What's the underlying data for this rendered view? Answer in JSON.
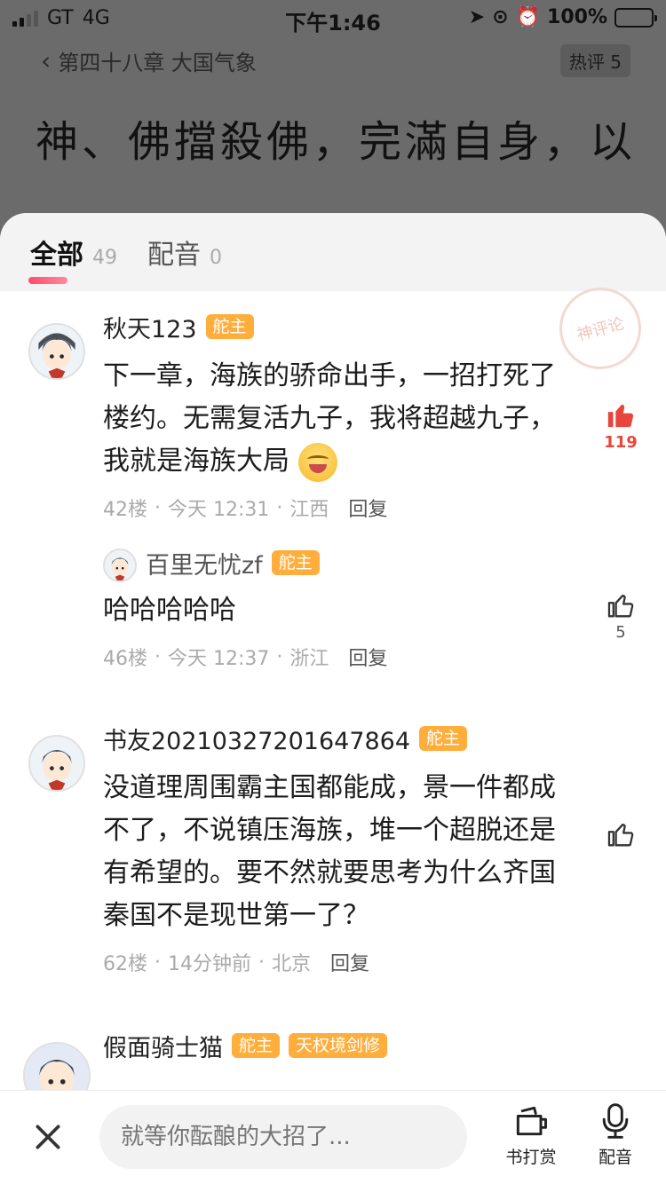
{
  "status_bar": {
    "carrier": "GT",
    "network": "4G",
    "time": "下午1:46",
    "battery": "100%"
  },
  "reader": {
    "chapter_title": "第四十八章 大国气象",
    "hot_label": "热评 5",
    "text": "神、佛擋殺佛，完滿自身，以"
  },
  "tabs": [
    {
      "label": "全部",
      "count": "49"
    },
    {
      "label": "配音",
      "count": "0"
    }
  ],
  "stamp": "神评论",
  "comments": [
    {
      "user": "秋天123",
      "badges": [
        "舵主"
      ],
      "text": "下一章，海族的骄命出手，一招打死了楼约。无需复活九子，我将超越九子，我就是海族大局",
      "emoji": "grinning-emoji",
      "floor": "42楼",
      "time": "今天 12:31",
      "location": "江西",
      "reply": "回复",
      "likes": "119",
      "reply_item": {
        "user": "百里无忧zf",
        "badges": [
          "舵主"
        ],
        "text": "哈哈哈哈哈",
        "floor": "46楼",
        "time": "今天 12:37",
        "location": "浙江",
        "reply": "回复",
        "likes": "5"
      }
    },
    {
      "user": "书友20210327201647864",
      "badges": [
        "舵主"
      ],
      "text": "没道理周围霸主国都能成，景一件都成不了，不说镇压海族，堆一个超脱还是有希望的。要不然就要思考为什么齐国秦国不是现世第一了？",
      "floor": "62楼",
      "time": "14分钟前",
      "location": "北京",
      "reply": "回复",
      "likes": ""
    },
    {
      "user": "假面骑士猫",
      "badges": [
        "舵主",
        "天权境剑修"
      ]
    }
  ],
  "bottom_bar": {
    "input_placeholder": "就等你酝酿的大招了...",
    "reward_label": "书打赏",
    "dub_label": "配音"
  },
  "colors": {
    "badge": "#ffad3b",
    "like_active": "#e8453c",
    "tab_indicator": "#ff4b6e"
  }
}
